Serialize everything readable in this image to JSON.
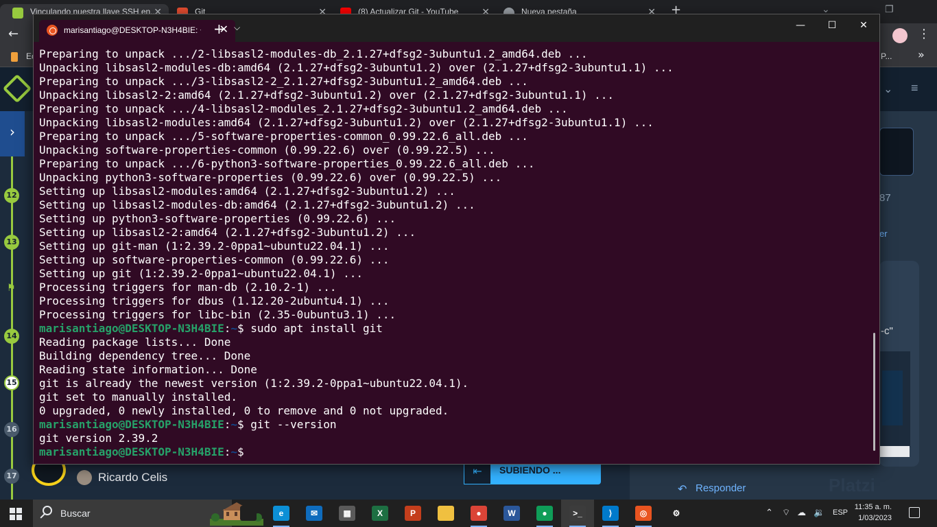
{
  "browser": {
    "tabs": [
      {
        "title": "Vinculando nuestra llave SSH en...",
        "favicon_color": "#98ca3f"
      },
      {
        "title": "Git",
        "favicon_color": "#e84e31"
      },
      {
        "title": "(8) Actualizar Git - YouTube",
        "favicon_color": "#ff0000"
      },
      {
        "title": "Nueva pestaña",
        "favicon_color": "#9aa0a6"
      }
    ],
    "new_tab_label": "+",
    "bookmark_fragment": "Ec",
    "bookmark_fragment_right": "P..."
  },
  "platzi": {
    "timeline": [
      "12",
      "13",
      "14",
      "15",
      "16",
      "17"
    ],
    "current_class": "15",
    "teacher_name": "Ricardo Celis",
    "next_class_label": "SUBIENDO ...",
    "reply_label": "Responder",
    "right_fragment_1": "87",
    "right_fragment_2": "er",
    "right_fragment_3": "-c\"",
    "watermark": "Platzi"
  },
  "terminal": {
    "tab_title": "marisantiago@DESKTOP-N3H4BIE: ~",
    "prompt_user": "marisantiago@DESKTOP-N3H4BIE",
    "prompt_sep": ":",
    "prompt_path": "~",
    "prompt_symbol": "$",
    "lines": [
      {
        "kind": "out",
        "text": "Preparing to unpack .../2-libsasl2-modules-db_2.1.27+dfsg2-3ubuntu1.2_amd64.deb ..."
      },
      {
        "kind": "out",
        "text": "Unpacking libsasl2-modules-db:amd64 (2.1.27+dfsg2-3ubuntu1.2) over (2.1.27+dfsg2-3ubuntu1.1) ..."
      },
      {
        "kind": "out",
        "text": "Preparing to unpack .../3-libsasl2-2_2.1.27+dfsg2-3ubuntu1.2_amd64.deb ..."
      },
      {
        "kind": "out",
        "text": "Unpacking libsasl2-2:amd64 (2.1.27+dfsg2-3ubuntu1.2) over (2.1.27+dfsg2-3ubuntu1.1) ..."
      },
      {
        "kind": "out",
        "text": "Preparing to unpack .../4-libsasl2-modules_2.1.27+dfsg2-3ubuntu1.2_amd64.deb ..."
      },
      {
        "kind": "out",
        "text": "Unpacking libsasl2-modules:amd64 (2.1.27+dfsg2-3ubuntu1.2) over (2.1.27+dfsg2-3ubuntu1.1) ..."
      },
      {
        "kind": "out",
        "text": "Preparing to unpack .../5-software-properties-common_0.99.22.6_all.deb ..."
      },
      {
        "kind": "out",
        "text": "Unpacking software-properties-common (0.99.22.6) over (0.99.22.5) ..."
      },
      {
        "kind": "out",
        "text": "Preparing to unpack .../6-python3-software-properties_0.99.22.6_all.deb ..."
      },
      {
        "kind": "out",
        "text": "Unpacking python3-software-properties (0.99.22.6) over (0.99.22.5) ..."
      },
      {
        "kind": "out",
        "text": "Setting up libsasl2-modules:amd64 (2.1.27+dfsg2-3ubuntu1.2) ..."
      },
      {
        "kind": "out",
        "text": "Setting up libsasl2-modules-db:amd64 (2.1.27+dfsg2-3ubuntu1.2) ..."
      },
      {
        "kind": "out",
        "text": "Setting up python3-software-properties (0.99.22.6) ..."
      },
      {
        "kind": "out",
        "text": "Setting up libsasl2-2:amd64 (2.1.27+dfsg2-3ubuntu1.2) ..."
      },
      {
        "kind": "out",
        "text": "Setting up git-man (1:2.39.2-0ppa1~ubuntu22.04.1) ..."
      },
      {
        "kind": "out",
        "text": "Setting up software-properties-common (0.99.22.6) ..."
      },
      {
        "kind": "out",
        "text": "Setting up git (1:2.39.2-0ppa1~ubuntu22.04.1) ..."
      },
      {
        "kind": "out",
        "text": "Processing triggers for man-db (2.10.2-1) ..."
      },
      {
        "kind": "out",
        "text": "Processing triggers for dbus (1.12.20-2ubuntu4.1) ..."
      },
      {
        "kind": "out",
        "text": "Processing triggers for libc-bin (2.35-0ubuntu3.1) ..."
      },
      {
        "kind": "cmd",
        "text": " sudo apt install git"
      },
      {
        "kind": "out",
        "text": "Reading package lists... Done"
      },
      {
        "kind": "out",
        "text": "Building dependency tree... Done"
      },
      {
        "kind": "out",
        "text": "Reading state information... Done"
      },
      {
        "kind": "out",
        "text": "git is already the newest version (1:2.39.2-0ppa1~ubuntu22.04.1)."
      },
      {
        "kind": "out",
        "text": "git set to manually installed."
      },
      {
        "kind": "out",
        "text": "0 upgraded, 0 newly installed, 0 to remove and 0 not upgraded."
      },
      {
        "kind": "cmd",
        "text": " git --version"
      },
      {
        "kind": "out",
        "text": "git version 2.39.2"
      },
      {
        "kind": "cmd",
        "text": ""
      }
    ]
  },
  "taskbar": {
    "search_label": "Buscar",
    "apps": [
      {
        "name": "task-view",
        "glyph": "",
        "color": "#202020"
      },
      {
        "name": "edge",
        "glyph": "e",
        "color": "#0c8fd6"
      },
      {
        "name": "mail",
        "glyph": "✉",
        "color": "#0f6cbd"
      },
      {
        "name": "calculator",
        "glyph": "▦",
        "color": "#5a5a5a"
      },
      {
        "name": "excel",
        "glyph": "X",
        "color": "#1d6f42"
      },
      {
        "name": "powerpoint",
        "glyph": "P",
        "color": "#c43e1c"
      },
      {
        "name": "file-explorer",
        "glyph": "",
        "color": "#f0c040"
      },
      {
        "name": "chrome",
        "glyph": "●",
        "color": "#db4437"
      },
      {
        "name": "word",
        "glyph": "W",
        "color": "#2b579a"
      },
      {
        "name": "chrome-profile",
        "glyph": "●",
        "color": "#0f9d58"
      },
      {
        "name": "terminal",
        "glyph": ">_",
        "color": "#3c3c3c"
      },
      {
        "name": "vscode",
        "glyph": "⟩",
        "color": "#007acc"
      },
      {
        "name": "ubuntu",
        "glyph": "◎",
        "color": "#e95420"
      },
      {
        "name": "settings",
        "glyph": "⚙",
        "color": "#202020"
      }
    ],
    "language": "ESP",
    "time": "11:35 a. m.",
    "date": "1/03/2023"
  }
}
